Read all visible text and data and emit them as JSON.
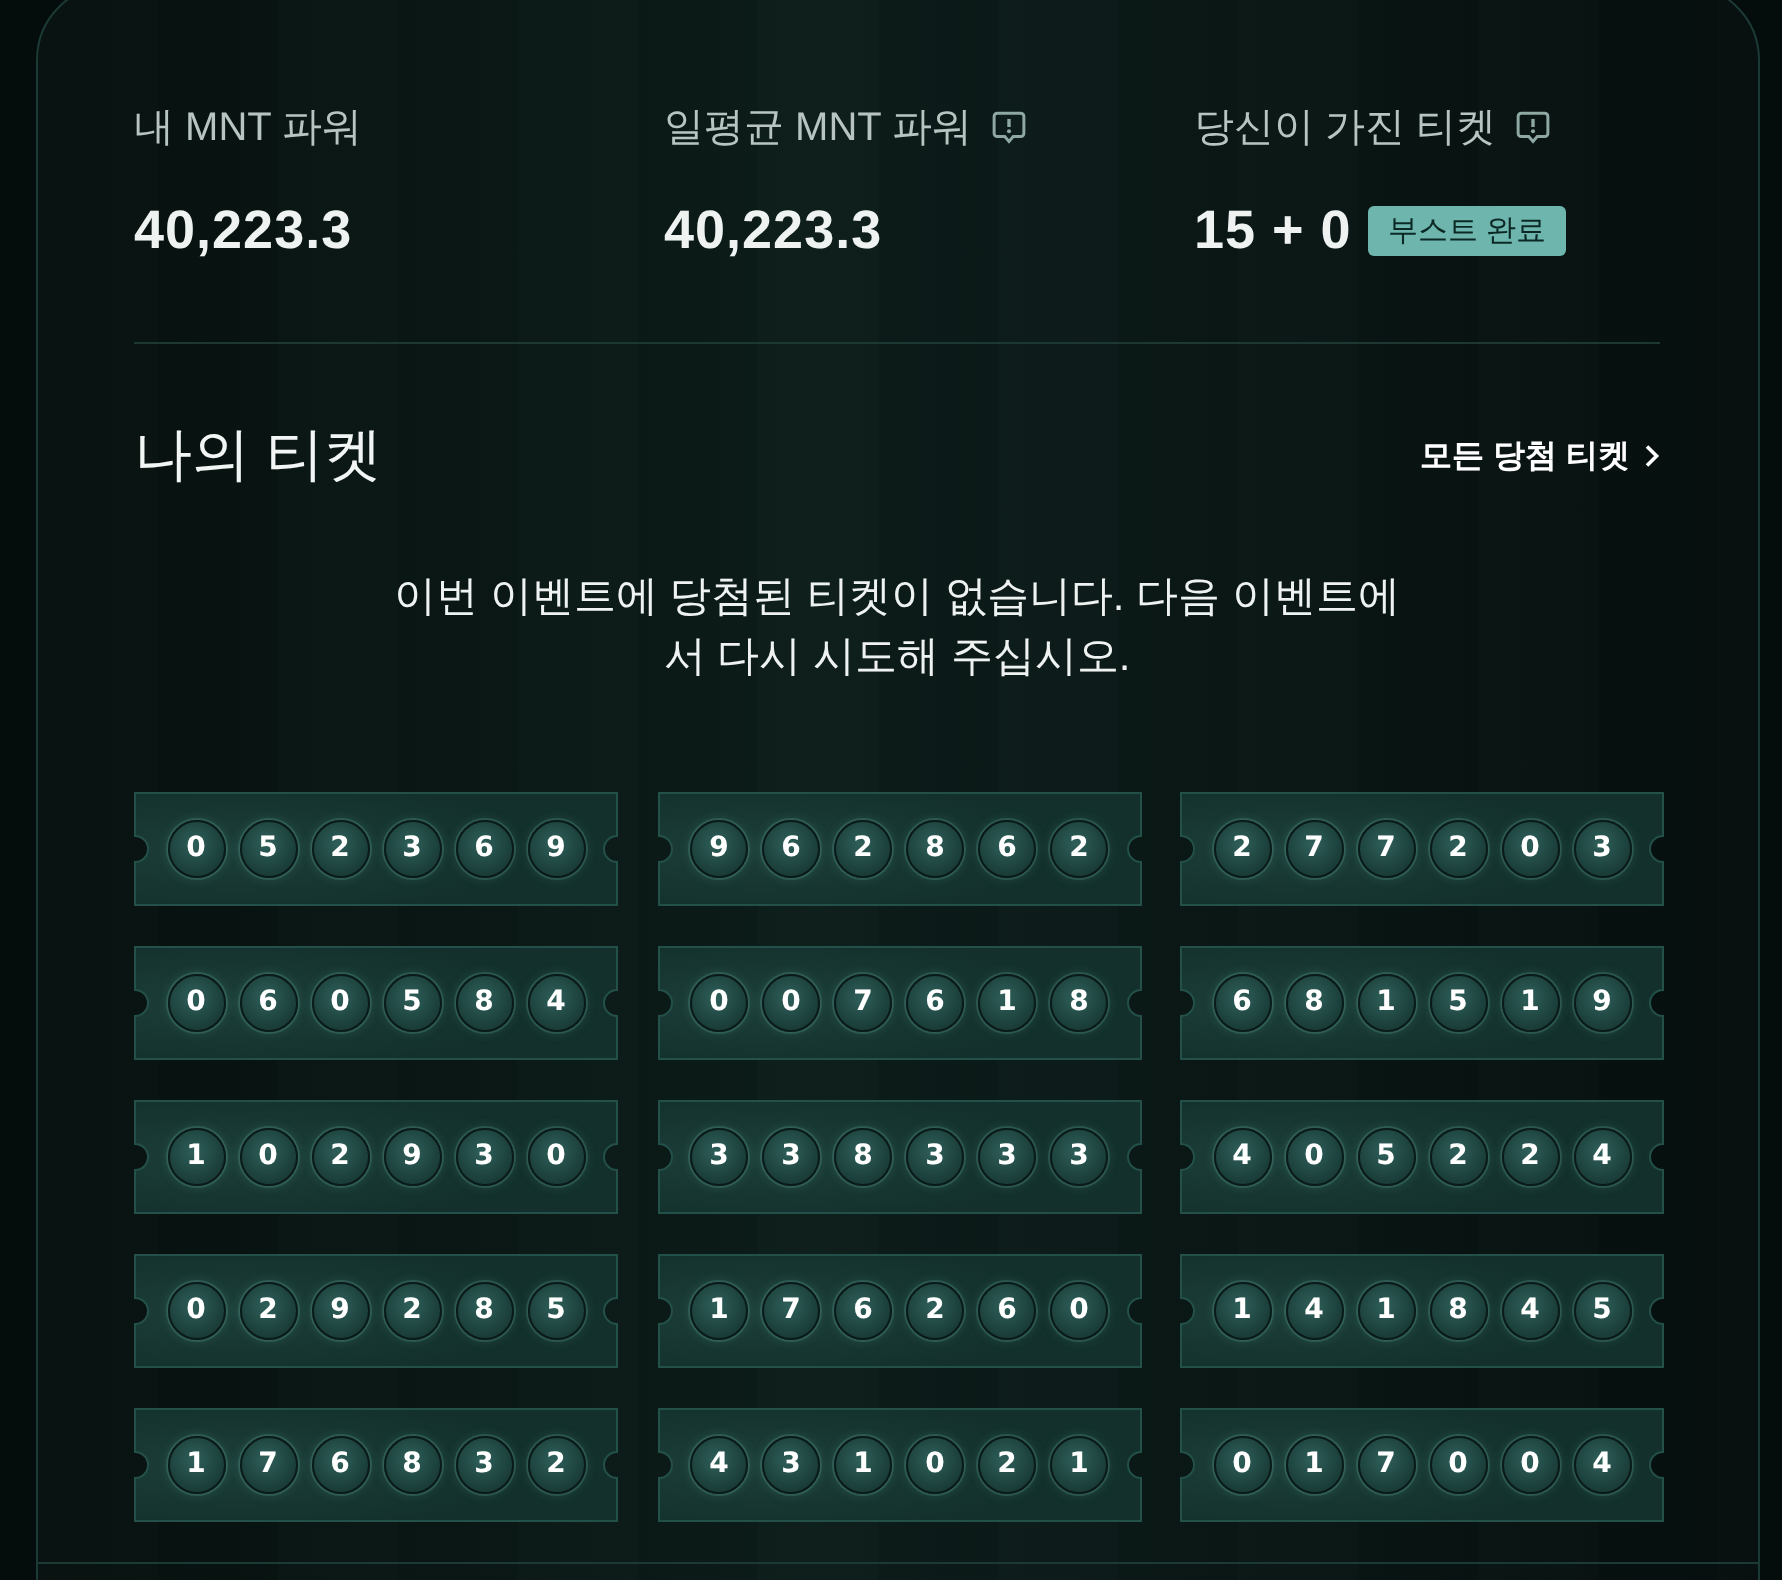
{
  "stats": [
    {
      "label": "내 MNT 파워",
      "value": "40,223.3",
      "info": false
    },
    {
      "label": "일평균 MNT 파워",
      "value": "40,223.3",
      "info": true
    },
    {
      "label": "당신이 가진 티켓",
      "value": "15 + 0",
      "info": true,
      "badge": "부스트 완료"
    }
  ],
  "section": {
    "title": "나의 티켓",
    "link": "모든 당첨 티켓"
  },
  "message": "이번 이벤트에 당첨된 티켓이 없습니다. 다음 이벤트에서 다시 시도해 주십시오.",
  "tickets": [
    {
      "digits": [
        "0",
        "5",
        "2",
        "3",
        "6",
        "9"
      ]
    },
    {
      "digits": [
        "9",
        "6",
        "2",
        "8",
        "6",
        "2"
      ]
    },
    {
      "digits": [
        "2",
        "7",
        "7",
        "2",
        "0",
        "3"
      ]
    },
    {
      "digits": [
        "0",
        "6",
        "0",
        "5",
        "8",
        "4"
      ]
    },
    {
      "digits": [
        "0",
        "0",
        "7",
        "6",
        "1",
        "8"
      ]
    },
    {
      "digits": [
        "6",
        "8",
        "1",
        "5",
        "1",
        "9"
      ]
    },
    {
      "digits": [
        "1",
        "0",
        "2",
        "9",
        "3",
        "0"
      ]
    },
    {
      "digits": [
        "3",
        "3",
        "8",
        "3",
        "3",
        "3"
      ]
    },
    {
      "digits": [
        "4",
        "0",
        "5",
        "2",
        "2",
        "4"
      ]
    },
    {
      "digits": [
        "0",
        "2",
        "9",
        "2",
        "8",
        "5"
      ]
    },
    {
      "digits": [
        "1",
        "7",
        "6",
        "2",
        "6",
        "0"
      ]
    },
    {
      "digits": [
        "1",
        "4",
        "1",
        "8",
        "4",
        "5"
      ]
    },
    {
      "digits": [
        "1",
        "7",
        "6",
        "8",
        "3",
        "2"
      ]
    },
    {
      "digits": [
        "4",
        "3",
        "1",
        "0",
        "2",
        "1"
      ]
    },
    {
      "digits": [
        "0",
        "1",
        "7",
        "0",
        "0",
        "4"
      ]
    }
  ]
}
